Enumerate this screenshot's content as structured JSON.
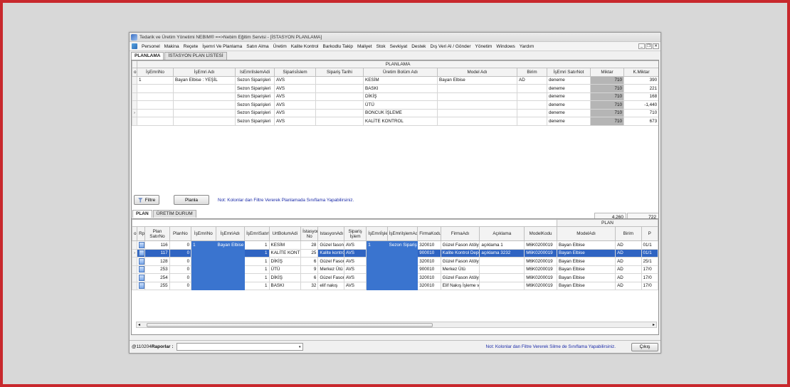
{
  "window": {
    "title": "Tedarik ve Üretim Yönetimi   NEBIM®  ==>Nebim Eğitim Servisi - [İSTASYON PLANLAMA]"
  },
  "menu": [
    "Personel",
    "Makina",
    "Reçete",
    "İşemri Ve Planlama",
    "Satın Alma",
    "Üretim",
    "Kalite Kontrol",
    "Barkodlu Takip",
    "Maliyet",
    "Stok",
    "Sevkiyat",
    "Destek",
    "Dış Veri Al / Gönder",
    "Yönetim",
    "Windows",
    "Yardım"
  ],
  "top_tabs": [
    "PLANLAMA",
    "İSTASYON PLAN LİSTESİ"
  ],
  "planlama": {
    "band": "PLANLAMA",
    "columns": [
      "İşEmriNo",
      "İşEmri Adı",
      "IsEmriIslemAdi",
      "Siparisİslem",
      "Sipariş Tarihi",
      "Üretim Bolüm Adı",
      "Model Adı",
      "Birim",
      "İşEmri SatırNot",
      "Miktar",
      "K.Miktar"
    ],
    "rows": [
      [
        "1",
        "Bayan Elbise : YEŞİL",
        "Sezon Siparişleri",
        "AVS",
        "",
        "KESİM",
        "Bayan Elbise",
        "AD",
        "deneme",
        "710",
        "390"
      ],
      [
        "",
        "",
        "Sezon Siparişleri",
        "AVS",
        "",
        "BASKI",
        "",
        "",
        "deneme",
        "710",
        "221"
      ],
      [
        "",
        "",
        "Sezon Siparişleri",
        "AVS",
        "",
        "DİKİŞ",
        "",
        "",
        "deneme",
        "710",
        "168"
      ],
      [
        "",
        "",
        "Sezon Siparişleri",
        "AVS",
        "",
        "ÜTÜ",
        "",
        "",
        "deneme",
        "710",
        "-1,440"
      ],
      [
        "",
        "",
        "Sezon Siparişleri",
        "AVS",
        "",
        "BONCUK İŞLEME",
        "",
        "",
        "deneme",
        "710",
        "710"
      ],
      [
        "",
        "",
        "Sezon Siparişleri",
        "AVS",
        "",
        "KALİTE KONTROL",
        "",
        "",
        "deneme",
        "710",
        "673"
      ]
    ],
    "totals": [
      "4,260",
      "722"
    ]
  },
  "toolbar": {
    "filter_label": "Filtre",
    "plan_label": "Planla",
    "note": "Not: Kolonlar dan Filtre Vererek Planlamada Sınıflama Yapabilirsiniz."
  },
  "bottom_tabs": [
    "PLAN",
    "ÜRETİM DURUM"
  ],
  "plan": {
    "band": "PLAN",
    "columns": [
      "Rp",
      "Plan SatırNo",
      "PlanNo",
      "İşEmriNo",
      "İşEmriAdı",
      "İşEmriSatırNo",
      "UrtBolumAdi",
      "İstasyon No",
      "IstasyonAdı",
      "Sipariş İşlem",
      "İşEmriİşlemNo",
      "İşEmriIşlemAdı",
      "FirmaKodu",
      "FirmaAdı",
      "Açıklama",
      "ModelKodu",
      "ModelAdı",
      "Birim",
      "P"
    ],
    "rows": [
      [
        "",
        "116",
        "0",
        "1",
        "Bayan Elbise : ",
        "1",
        "KESİM",
        "28",
        "Güzel fason",
        "AVS",
        "1",
        "Sezon Siparişle",
        "320010",
        "Güzel Fason Atölyes",
        "açıklama 1",
        "M6K0200019",
        "Bayan Elbise",
        "AD",
        "01/1"
      ],
      [
        "",
        "117",
        "0",
        "",
        "",
        "1",
        "KALİTE KONTRC",
        "25",
        "Kalite kontro",
        "AVS",
        "",
        "",
        "900010",
        "Kalite Kontrol Depos",
        "açıklama 3232",
        "M6K0200019",
        "Bayan Elbise",
        "AD",
        "01/1"
      ],
      [
        "",
        "128",
        "0",
        "",
        "",
        "1",
        "DİKİŞ",
        "6",
        "Güzel Fason",
        "AVS",
        "",
        "",
        "320010",
        "Güzel Fason Atölyes",
        "",
        "M6K0200019",
        "Bayan Elbise",
        "AD",
        "25/1"
      ],
      [
        "",
        "253",
        "0",
        "",
        "",
        "1",
        "ÜTÜ",
        "9",
        "Merkez Ütü",
        "AVS",
        "",
        "",
        "900010",
        "Merkez Ütü",
        "",
        "M6K0200019",
        "Bayan Elbise",
        "AD",
        "17/0"
      ],
      [
        "",
        "254",
        "0",
        "",
        "",
        "1",
        "DİKİŞ",
        "6",
        "Güzel Fason",
        "AVS",
        "",
        "",
        "320010",
        "Güzel Fason Atölyes",
        "",
        "M6K0200019",
        "Bayan Elbise",
        "AD",
        "17/0"
      ],
      [
        "",
        "255",
        "0",
        "",
        "",
        "1",
        "BASKI",
        "32",
        "elif nakış",
        "AVS",
        "",
        "",
        "320010",
        "Elif Nakış İşleme ve",
        "",
        "M6K0200019",
        "Bayan Elbise",
        "AD",
        "17/0"
      ]
    ]
  },
  "status": {
    "user": "@110204",
    "reports_label": "Raporlar :",
    "note": "Not: Kolonlar dan Filtre Vererek Silme de Sınıflama Yapabilirsiniz.",
    "exit_label": "Çıkış"
  }
}
